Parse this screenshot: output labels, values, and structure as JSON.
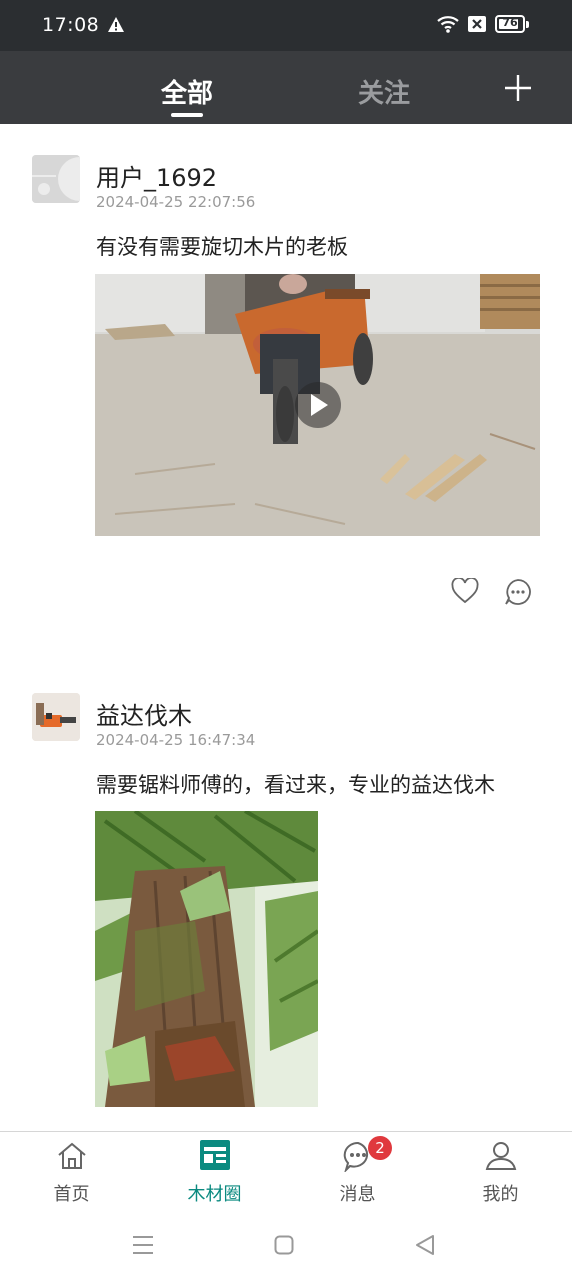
{
  "status_bar": {
    "time": "17:08",
    "battery": "76",
    "icons": [
      "warning-icon",
      "wifi-icon",
      "sim-icon",
      "battery-icon"
    ]
  },
  "top_nav": {
    "tabs": [
      {
        "label": "全部",
        "active": true
      },
      {
        "label": "关注",
        "active": false
      }
    ],
    "add_icon": "plus-icon"
  },
  "posts": [
    {
      "username": "用户_1692",
      "timestamp": "2024-04-25 22:07:56",
      "text": "有没有需要旋切木片的老板",
      "media_type": "video",
      "actions": [
        "heart-icon",
        "comment-icon"
      ]
    },
    {
      "username": "益达伐木",
      "timestamp": "2024-04-25 16:47:34",
      "text": "需要锯料师傅的，看过来，专业的益达伐木",
      "media_type": "image"
    }
  ],
  "bottom_tabs": [
    {
      "label": "首页",
      "icon": "home-icon",
      "active": false
    },
    {
      "label": "木材圈",
      "icon": "feed-icon",
      "active": true
    },
    {
      "label": "消息",
      "icon": "message-icon",
      "active": false,
      "badge": "2"
    },
    {
      "label": "我的",
      "icon": "profile-icon",
      "active": false
    }
  ],
  "colors": {
    "accent": "#0b8a80",
    "status_bar": "#2b2e31",
    "top_nav": "#3a3c3f",
    "badge": "#e0393e"
  }
}
